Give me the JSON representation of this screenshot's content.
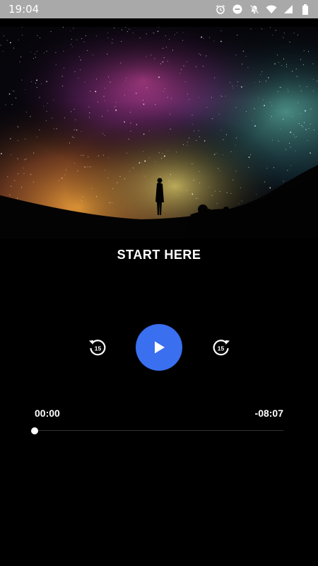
{
  "status_bar": {
    "time": "19:04",
    "icons": [
      "alarm-icon",
      "dnd-icon",
      "mute-icon",
      "wifi-icon",
      "signal-icon",
      "battery-icon"
    ]
  },
  "player": {
    "title": "START HERE",
    "elapsed": "00:00",
    "remaining": "-08:07",
    "progress_fraction": 0,
    "rewind_seconds": "15",
    "forward_seconds": "15",
    "accent_color": "#3a6ff0"
  }
}
